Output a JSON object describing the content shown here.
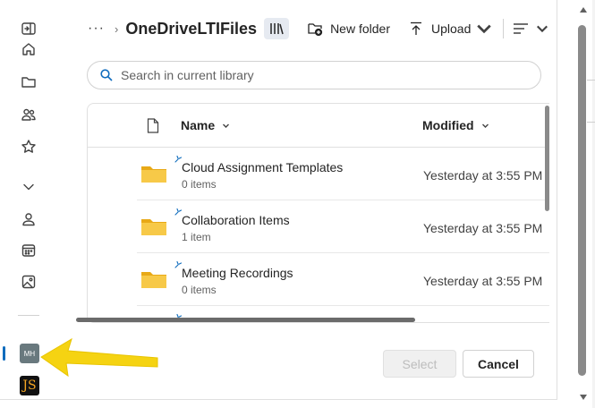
{
  "toolbar": {
    "title": "OneDriveLTIFiles",
    "more": "···",
    "separator": "›",
    "new_folder_label": "New folder",
    "upload_label": "Upload"
  },
  "search": {
    "placeholder": "Search in current library"
  },
  "list": {
    "columns": {
      "name": "Name",
      "modified": "Modified"
    },
    "rows": [
      {
        "name": "Cloud Assignment Templates",
        "meta": "0 items",
        "modified": "Yesterday at 3:55 PM"
      },
      {
        "name": "Collaboration Items",
        "meta": "1 item",
        "modified": "Yesterday at 3:55 PM"
      },
      {
        "name": "Meeting Recordings",
        "meta": "0 items",
        "modified": "Yesterday at 3:55 PM"
      }
    ]
  },
  "rail": {
    "avatar_mh": "MH",
    "avatar_js": "JS"
  },
  "actions": {
    "select_label": "Select",
    "cancel_label": "Cancel"
  },
  "colors": {
    "accent": "#0f6cbd",
    "folder": "#f7c948",
    "arrow": "#f5d312"
  }
}
